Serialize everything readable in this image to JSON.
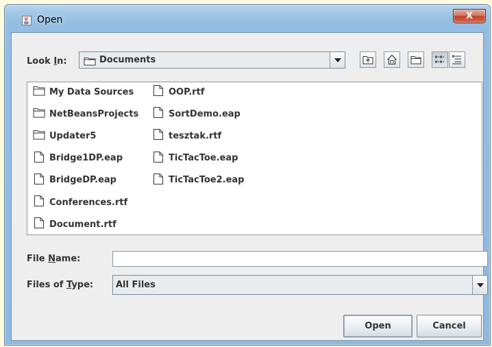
{
  "window": {
    "title": "Open",
    "close_glyph": "X"
  },
  "look_in": {
    "label_pre": "Look ",
    "label_mnemonic": "I",
    "label_post": "n:",
    "value": "Documents",
    "folder_icon": "folder-icon"
  },
  "toolbar": {
    "buttons": [
      "up-one-level-icon",
      "home-icon",
      "new-folder-icon",
      "list-view-icon",
      "details-view-icon"
    ],
    "active": "list-view-icon"
  },
  "files": {
    "column1": [
      {
        "name": "My Data Sources",
        "icon": "folder-icon"
      },
      {
        "name": "NetBeansProjects",
        "icon": "folder-icon"
      },
      {
        "name": "Updater5",
        "icon": "folder-icon"
      },
      {
        "name": "Bridge1DP.eap",
        "icon": "file-icon"
      },
      {
        "name": "BridgeDP.eap",
        "icon": "file-icon"
      },
      {
        "name": "Conferences.rtf",
        "icon": "file-icon"
      },
      {
        "name": "Document.rtf",
        "icon": "file-icon"
      }
    ],
    "column2": [
      {
        "name": "OOP.rtf",
        "icon": "file-icon"
      },
      {
        "name": "SortDemo.eap",
        "icon": "file-icon"
      },
      {
        "name": "tesztak.rtf",
        "icon": "file-icon"
      },
      {
        "name": "TicTacToe.eap",
        "icon": "file-icon"
      },
      {
        "name": "TicTacToe2.eap",
        "icon": "file-icon"
      }
    ]
  },
  "file_name": {
    "label_pre": "File ",
    "label_mnemonic": "N",
    "label_post": "ame:",
    "value": ""
  },
  "file_type": {
    "label_pre": "Files of ",
    "label_mnemonic": "T",
    "label_post": "ype:",
    "value": "All Files"
  },
  "buttons": {
    "open": "Open",
    "cancel": "Cancel"
  },
  "colors": {
    "frame": "#8fb9df",
    "panel": "#eeeeee",
    "close": "#c2422c"
  }
}
